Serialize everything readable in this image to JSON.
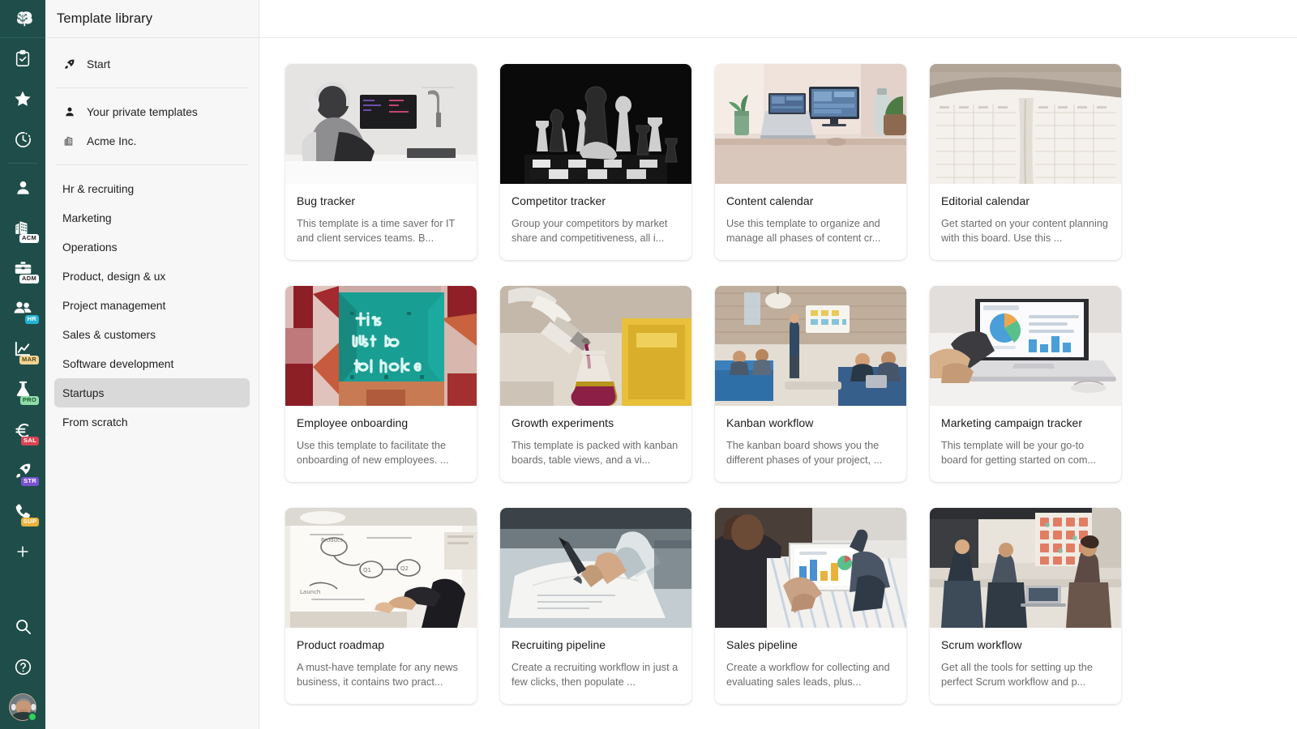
{
  "rail": {
    "logo": {
      "name": "brain-tree-logo",
      "label": "App logo"
    },
    "items": [
      {
        "name": "clipboard-check-icon",
        "label": "Tasks"
      },
      {
        "name": "star-icon",
        "label": "Favorites"
      },
      {
        "name": "clock-icon",
        "label": "Recent"
      }
    ],
    "workspaces": [
      {
        "name": "person-icon",
        "label": "Personal",
        "badge": "",
        "badge_color": ""
      },
      {
        "name": "buildings-icon",
        "label": "Acme Inc.",
        "badge": "ACM",
        "badge_color": "#ffffff",
        "badge_text_color": "#1f1f1f"
      },
      {
        "name": "briefcase-icon",
        "label": "Administration",
        "badge": "ADM",
        "badge_color": "#ffffff",
        "badge_text_color": "#1f1f1f"
      },
      {
        "name": "people-icon",
        "label": "HR",
        "badge": "HR",
        "badge_color": "#23b3d4",
        "badge_text_color": "#ffffff"
      },
      {
        "name": "line-chart-icon",
        "label": "Marketing",
        "badge": "MAR",
        "badge_color": "#f2d492",
        "badge_text_color": "#5a4a17"
      },
      {
        "name": "flask-icon",
        "label": "Product",
        "badge": "PRO",
        "badge_color": "#8fdca8",
        "badge_text_color": "#1d5733"
      },
      {
        "name": "euro-icon",
        "label": "Sales",
        "badge": "SAL",
        "badge_color": "#d94452",
        "badge_text_color": "#ffffff"
      },
      {
        "name": "rocket-icon",
        "label": "Startups",
        "badge": "STR",
        "badge_color": "#7a52d1",
        "badge_text_color": "#ffffff"
      },
      {
        "name": "phone-icon",
        "label": "Support",
        "badge": "SUP",
        "badge_color": "#e8b23a",
        "badge_text_color": "#ffffff"
      }
    ],
    "add_button": {
      "name": "add-workspace-icon",
      "label": "+"
    },
    "bottom": [
      {
        "name": "search-icon",
        "label": "Search"
      },
      {
        "name": "help-icon",
        "label": "Help"
      }
    ],
    "avatar": {
      "name": "user-avatar",
      "label": "User profile",
      "presence": "online"
    },
    "background_color": "#1f4e4a"
  },
  "sidebar": {
    "title": "Template library",
    "primary": [
      {
        "label": "Start",
        "icon": "rocket-icon"
      }
    ],
    "sources": [
      {
        "label": "Your private templates",
        "icon": "person-icon"
      },
      {
        "label": "Acme Inc.",
        "icon": "buildings-icon"
      }
    ],
    "categories": [
      {
        "label": "Hr & recruiting",
        "active": false
      },
      {
        "label": "Marketing",
        "active": false
      },
      {
        "label": "Operations",
        "active": false
      },
      {
        "label": "Product, design & ux",
        "active": false
      },
      {
        "label": "Project management",
        "active": false
      },
      {
        "label": "Sales & customers",
        "active": false
      },
      {
        "label": "Software development",
        "active": false
      },
      {
        "label": "Startups",
        "active": true
      },
      {
        "label": "From scratch",
        "active": false
      }
    ],
    "active_category": "Startups",
    "background_color": "#f7f7f7",
    "active_background_color": "#d9d9d9"
  },
  "main": {
    "cards": [
      {
        "title": "Bug tracker",
        "description": "This template is a time saver for IT and client services teams. B...",
        "thumb": "developer-at-desk-photo"
      },
      {
        "title": "Competitor tracker",
        "description": "Group your competitors by market share and competitiveness, all i...",
        "thumb": "chess-board-photo"
      },
      {
        "title": "Content calendar",
        "description": "Use this template to organize and manage all phases of content cr...",
        "thumb": "desk-with-laptop-photo"
      },
      {
        "title": "Editorial calendar",
        "description": "Get started on your content planning with this board. Use this ...",
        "thumb": "open-planner-photo"
      },
      {
        "title": "Employee onboarding",
        "description": "Use this template to facilitate the onboarding of new employees. ...",
        "thumb": "neon-sign-this-must-be-the-place-photo"
      },
      {
        "title": "Growth experiments",
        "description": "This template is packed with kanban boards, table views, and a vi...",
        "thumb": "lab-flask-pouring-photo"
      },
      {
        "title": "Kanban workflow",
        "description": "The kanban board shows you the different phases of your project, ...",
        "thumb": "team-meeting-office-photo"
      },
      {
        "title": "Marketing campaign tracker",
        "description": "This template will be your go-to board for getting started on com...",
        "thumb": "laptop-dashboard-photo"
      },
      {
        "title": "Product roadmap",
        "description": "A must-have template for any news business, it contains two pract...",
        "thumb": "whiteboard-roadmap-photo"
      },
      {
        "title": "Recruiting pipeline",
        "description": "Create a recruiting workflow in just a few clicks, then populate ...",
        "thumb": "signing-document-photo"
      },
      {
        "title": "Sales pipeline",
        "description": "Create a workflow for collecting and evaluating sales leads, plus...",
        "thumb": "person-holding-tablet-photo"
      },
      {
        "title": "Scrum workflow",
        "description": "Get all the tools for setting up the perfect Scrum workflow and p...",
        "thumb": "team-sticky-notes-photo"
      }
    ]
  }
}
